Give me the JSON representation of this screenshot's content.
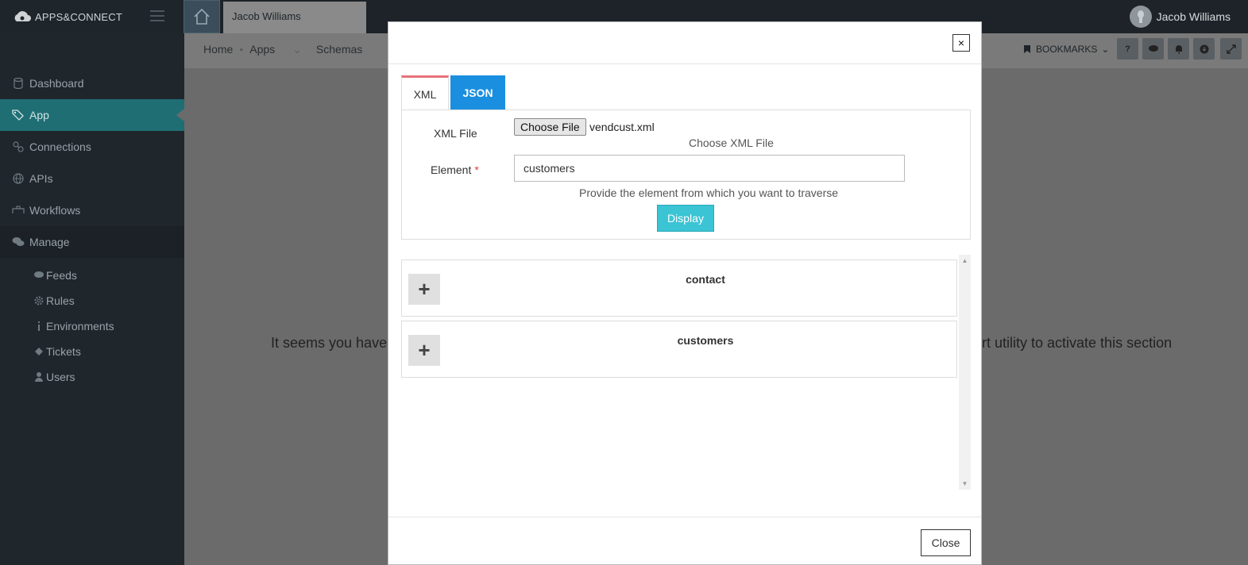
{
  "brand": {
    "name": "APPS&CONNECT"
  },
  "topbar": {
    "open_tab": "Jacob Williams",
    "user_name": "Jacob Williams"
  },
  "sidebar": {
    "items": [
      {
        "label": "Dashboard",
        "icon": "database-icon"
      },
      {
        "label": "App",
        "icon": "tags-icon",
        "active": true
      },
      {
        "label": "Connections",
        "icon": "link-icon"
      },
      {
        "label": "APIs",
        "icon": "globe-icon"
      },
      {
        "label": "Workflows",
        "icon": "workflow-icon"
      },
      {
        "label": "Manage",
        "icon": "comments-icon"
      }
    ],
    "subitems": [
      {
        "label": "Feeds",
        "icon": "comment-icon"
      },
      {
        "label": "Rules",
        "icon": "gear-icon"
      },
      {
        "label": "Environments",
        "icon": "info-icon"
      },
      {
        "label": "Tickets",
        "icon": "ticket-icon"
      },
      {
        "label": "Users",
        "icon": "user-icon"
      }
    ]
  },
  "breadcrumb": {
    "home": "Home",
    "apps": "Apps",
    "schemas": "Schemas"
  },
  "toolbar": {
    "bookmarks_label": "BOOKMARKS"
  },
  "background_message": {
    "left": "It seems you have",
    "right": "rt utility to activate this section"
  },
  "modal": {
    "tabs": {
      "xml": "XML",
      "json": "JSON"
    },
    "xml_file_label": "XML File",
    "choose_file_button": "Choose File",
    "chosen_file_name": "vendcust.xml",
    "choose_file_hint": "Choose XML File",
    "element_label": "Element",
    "required_mark": "*",
    "element_value": "customers",
    "element_hint": "Provide the element from which you want to traverse",
    "display_button": "Display",
    "tree_nodes": [
      {
        "title": "contact",
        "expand_symbol": "+"
      },
      {
        "title": "customers",
        "expand_symbol": "+"
      }
    ],
    "close_button": "Close",
    "close_x": "×"
  },
  "colors": {
    "accent_tab": "#1a8fe0",
    "display_button": "#3ac4d4",
    "active_sidebar": "#1f6e74",
    "tab_highlight": "#e8707a"
  }
}
